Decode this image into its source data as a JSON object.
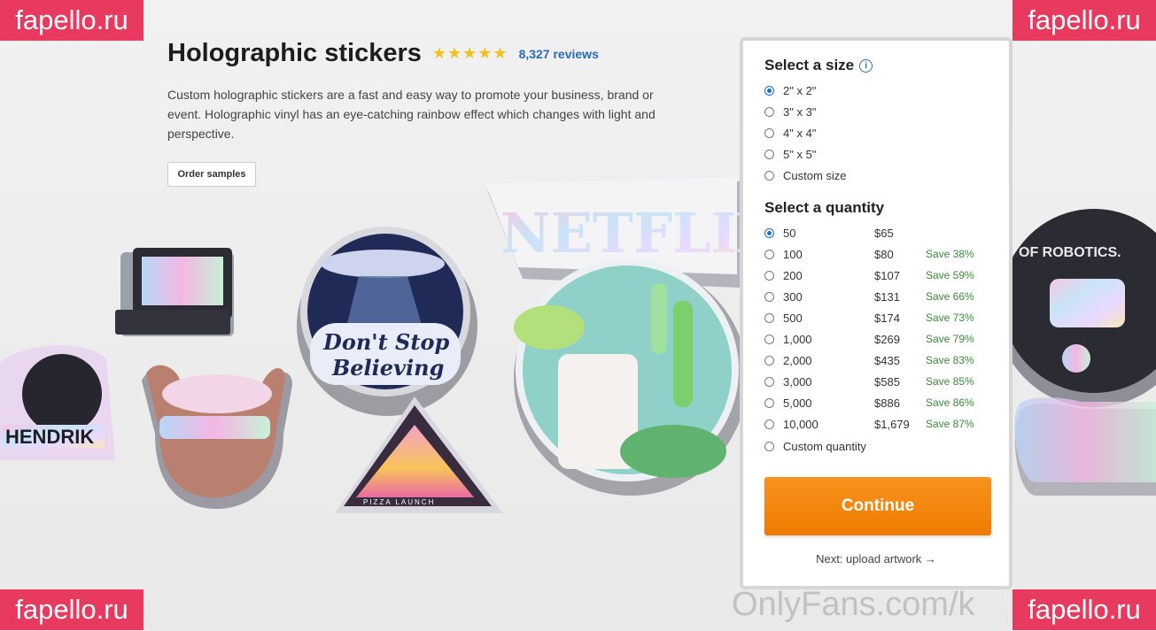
{
  "product": {
    "title": "Holographic stickers",
    "stars": "★★★★★",
    "reviews": "8,327 reviews",
    "description": "Custom holographic stickers are a fast and easy way to promote your business, brand or event. Holographic vinyl has an eye-catching rainbow effect which changes with light and perspective.",
    "samples_label": "Order samples"
  },
  "size": {
    "title": "Select a size",
    "info_icon": "i",
    "options": [
      {
        "label": "2\" x 2\"",
        "selected": true
      },
      {
        "label": "3\" x 3\"",
        "selected": false
      },
      {
        "label": "4\" x 4\"",
        "selected": false
      },
      {
        "label": "5\" x 5\"",
        "selected": false
      },
      {
        "label": "Custom size",
        "selected": false
      }
    ]
  },
  "quantity": {
    "title": "Select a quantity",
    "options": [
      {
        "qty": "50",
        "price": "$65",
        "save": "",
        "selected": true
      },
      {
        "qty": "100",
        "price": "$80",
        "save": "Save 38%",
        "selected": false
      },
      {
        "qty": "200",
        "price": "$107",
        "save": "Save 59%",
        "selected": false
      },
      {
        "qty": "300",
        "price": "$131",
        "save": "Save 66%",
        "selected": false
      },
      {
        "qty": "500",
        "price": "$174",
        "save": "Save 73%",
        "selected": false
      },
      {
        "qty": "1,000",
        "price": "$269",
        "save": "Save 79%",
        "selected": false
      },
      {
        "qty": "2,000",
        "price": "$435",
        "save": "Save 83%",
        "selected": false
      },
      {
        "qty": "3,000",
        "price": "$585",
        "save": "Save 85%",
        "selected": false
      },
      {
        "qty": "5,000",
        "price": "$886",
        "save": "Save 86%",
        "selected": false
      },
      {
        "qty": "10,000",
        "price": "$1,679",
        "save": "Save 87%",
        "selected": false
      }
    ],
    "custom_label": "Custom quantity"
  },
  "actions": {
    "continue": "Continue",
    "next": "Next: upload artwork →"
  },
  "watermarks": {
    "fapello": "fapello.ru",
    "onlyfans": "OnlyFans.com/k"
  },
  "stickers": {
    "dont_stop_1": "Don't Stop",
    "dont_stop_2": "Believing",
    "hendrik": "HENDRIK",
    "netflix": "NETFLIX",
    "robotics": "OF ROBOTICS.",
    "pizza": "PIZZA LAUNCH"
  },
  "colors": {
    "accent": "#ef7b00",
    "link": "#2a6ab7",
    "save": "#3b8a3a",
    "watermark": "#e8395e"
  }
}
